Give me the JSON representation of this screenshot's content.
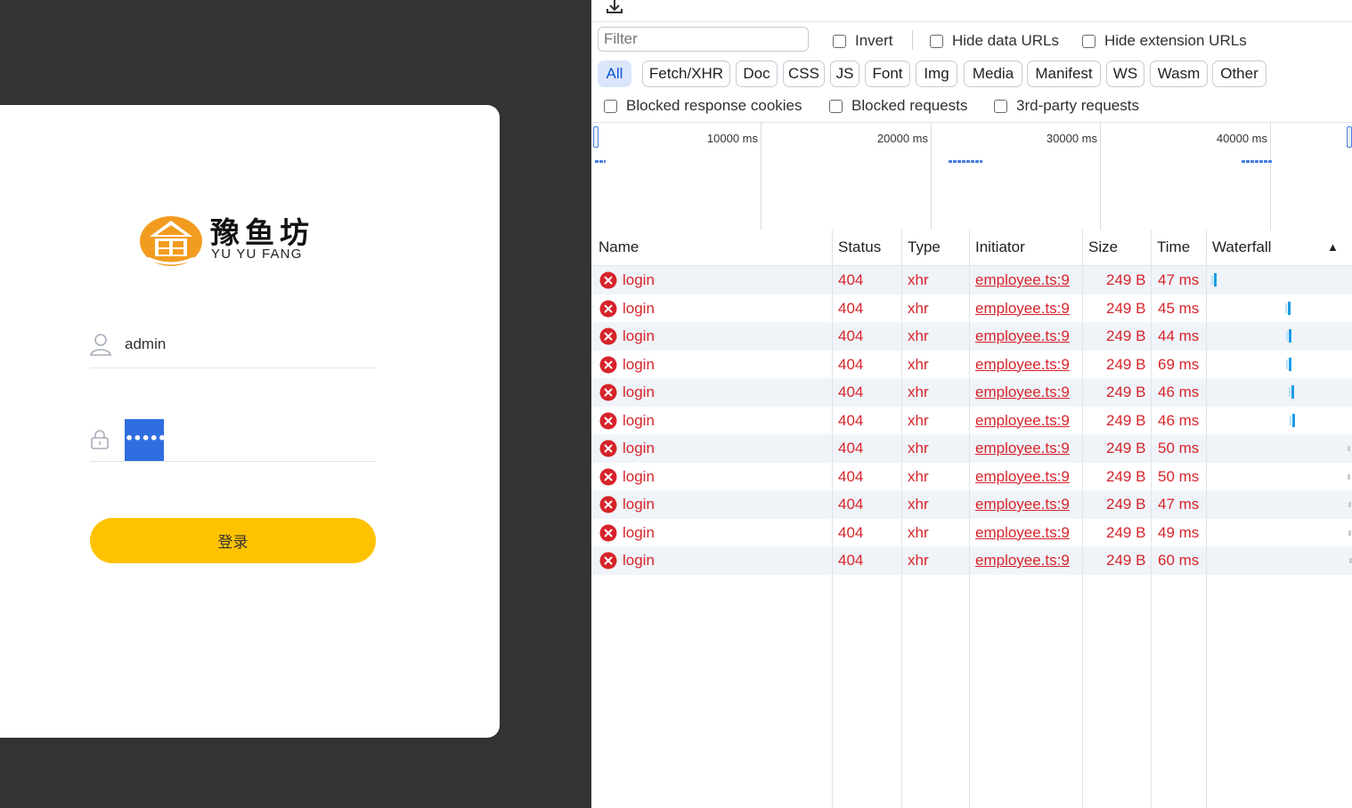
{
  "login": {
    "logo_cn": "豫鱼坊",
    "logo_en": "YU YU FANG",
    "username_value": "admin",
    "password_mask": "••••••",
    "submit_label": "登录"
  },
  "devtools": {
    "filter_placeholder": "Filter",
    "checks_row1": [
      "Invert",
      "Hide data URLs",
      "Hide extension URLs"
    ],
    "type_filters": [
      "All",
      "Fetch/XHR",
      "Doc",
      "CSS",
      "JS",
      "Font",
      "Img",
      "Media",
      "Manifest",
      "WS",
      "Wasm",
      "Other"
    ],
    "active_type_filter": "All",
    "checks_row2": [
      "Blocked response cookies",
      "Blocked requests",
      "3rd-party requests"
    ],
    "overview_ticks": [
      "10000 ms",
      "20000 ms",
      "30000 ms",
      "40000 ms"
    ],
    "columns": [
      "Name",
      "Status",
      "Type",
      "Initiator",
      "Size",
      "Time",
      "Waterfall"
    ],
    "sort_indicator": "▲",
    "requests": [
      {
        "name": "login",
        "status": "404",
        "type": "xhr",
        "initiator": "employee.ts:9",
        "size": "249 B",
        "time": "47 ms"
      },
      {
        "name": "login",
        "status": "404",
        "type": "xhr",
        "initiator": "employee.ts:9",
        "size": "249 B",
        "time": "45 ms"
      },
      {
        "name": "login",
        "status": "404",
        "type": "xhr",
        "initiator": "employee.ts:9",
        "size": "249 B",
        "time": "44 ms"
      },
      {
        "name": "login",
        "status": "404",
        "type": "xhr",
        "initiator": "employee.ts:9",
        "size": "249 B",
        "time": "69 ms"
      },
      {
        "name": "login",
        "status": "404",
        "type": "xhr",
        "initiator": "employee.ts:9",
        "size": "249 B",
        "time": "46 ms"
      },
      {
        "name": "login",
        "status": "404",
        "type": "xhr",
        "initiator": "employee.ts:9",
        "size": "249 B",
        "time": "46 ms"
      },
      {
        "name": "login",
        "status": "404",
        "type": "xhr",
        "initiator": "employee.ts:9",
        "size": "249 B",
        "time": "50 ms"
      },
      {
        "name": "login",
        "status": "404",
        "type": "xhr",
        "initiator": "employee.ts:9",
        "size": "249 B",
        "time": "50 ms"
      },
      {
        "name": "login",
        "status": "404",
        "type": "xhr",
        "initiator": "employee.ts:9",
        "size": "249 B",
        "time": "47 ms"
      },
      {
        "name": "login",
        "status": "404",
        "type": "xhr",
        "initiator": "employee.ts:9",
        "size": "249 B",
        "time": "49 ms"
      },
      {
        "name": "login",
        "status": "404",
        "type": "xhr",
        "initiator": "employee.ts:9",
        "size": "249 B",
        "time": "60 ms"
      }
    ],
    "colors": {
      "error": "#d6242a",
      "accent": "#0b57d0",
      "login_button": "#ffc200"
    }
  }
}
